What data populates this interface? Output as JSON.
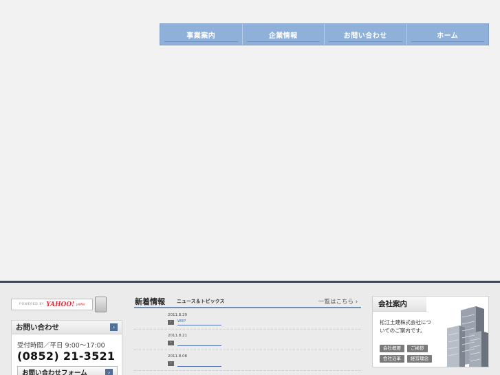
{
  "nav": {
    "items": [
      {
        "label": "事業案内"
      },
      {
        "label": "企業情報"
      },
      {
        "label": "お問い合わせ"
      },
      {
        "label": "ホーム"
      }
    ]
  },
  "search": {
    "powered_by": "POWERED BY",
    "brand": "YAHOO!",
    "brand_sub": "JAPAN"
  },
  "contact": {
    "title": "お問い合わせ",
    "hours": "受付時間／平日 9:00〜17:00",
    "phone": "(0852) 21-3521",
    "form_button": "お問い合わせフォーム"
  },
  "news": {
    "title": "新着情報",
    "subtitle": "ニュース＆トピックス",
    "view_all": "一覧はこちら ›",
    "items": [
      {
        "date": "2011.8.29",
        "link": "WEP"
      },
      {
        "date": "2011.8.21",
        "link": ""
      },
      {
        "date": "2011.8.08",
        "link": ""
      }
    ]
  },
  "company": {
    "title": "会社案内",
    "description": "松江土建株式会社についてのご案内です。",
    "tags": [
      "会社概要",
      "ご挨拶",
      "会社沿革",
      "経営理念"
    ]
  },
  "colors": {
    "nav_bg": "#8fb0d8",
    "accent": "#4f6f98",
    "divider": "#3f4752"
  }
}
